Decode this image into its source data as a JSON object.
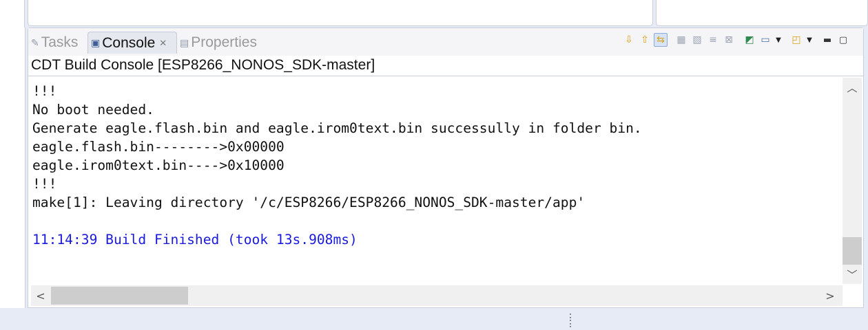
{
  "tabs": {
    "tasks": "Tasks",
    "console": "Console",
    "properties": "Properties"
  },
  "console": {
    "title": "CDT Build Console [ESP8266_NONOS_SDK-master]",
    "lines": [
      "!!!",
      "No boot needed.",
      "Generate eagle.flash.bin and eagle.irom0text.bin successully in folder bin.",
      "eagle.flash.bin-------->0x00000",
      "eagle.irom0text.bin---->0x10000",
      "!!!",
      "make[1]: Leaving directory '/c/ESP8266/ESP8266_NONOS_SDK-master/app'",
      "",
      "11:14:39 Build Finished (took 13s.908ms)"
    ]
  },
  "icons": {
    "tasks": "tasks-icon",
    "console": "console-icon",
    "properties": "properties-icon",
    "close": "close-icon",
    "next": "arrow-down-icon",
    "previous": "arrow-up-icon",
    "scroll_lock": "scroll-lock-icon",
    "clear": "clear-console-icon",
    "pin": "pin-console-icon",
    "word_wrap": "word-wrap-icon",
    "remove": "remove-launch-icon",
    "open_console": "open-console-icon",
    "display_console": "display-console-icon",
    "new_console": "new-console-icon",
    "minimize": "minimize-icon",
    "maximize": "maximize-icon"
  },
  "colors": {
    "build_finished": "#1a1adc",
    "default_text": "#111111"
  }
}
